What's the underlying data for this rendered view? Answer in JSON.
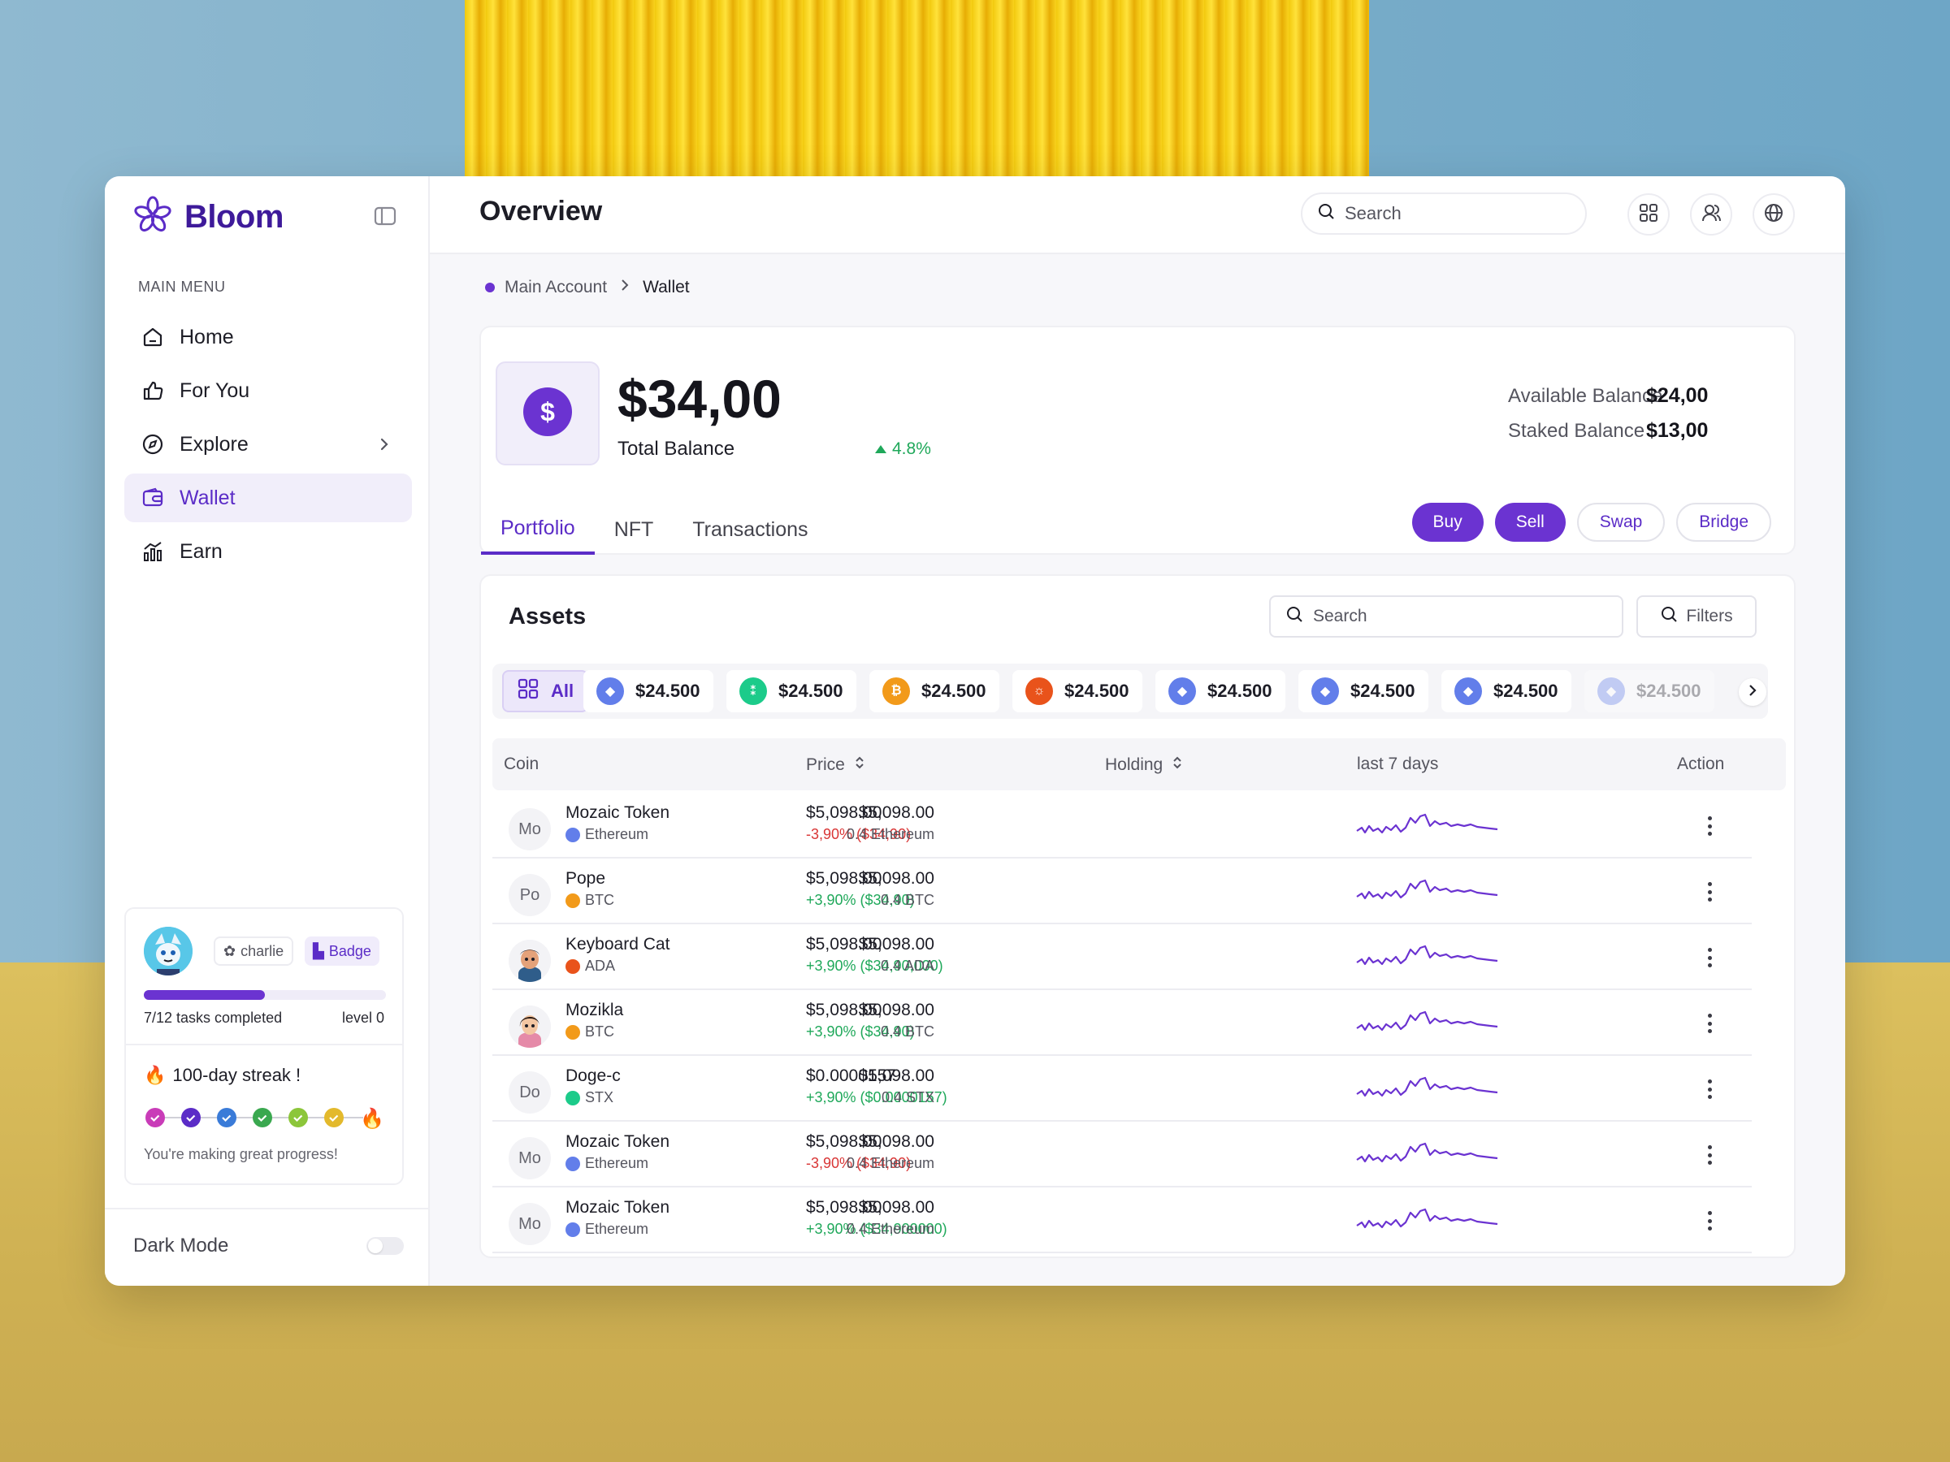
{
  "app": {
    "name": "Bloom"
  },
  "sidebar": {
    "menu_title": "MAIN MENU",
    "items": [
      {
        "label": "Home",
        "icon": "home-icon"
      },
      {
        "label": "For You",
        "icon": "thumbs-up-icon"
      },
      {
        "label": "Explore",
        "icon": "compass-icon"
      },
      {
        "label": "Wallet",
        "icon": "wallet-icon",
        "active": true
      },
      {
        "label": "Earn",
        "icon": "bar-chart-icon"
      }
    ],
    "profile": {
      "username": "charlie",
      "badge": "Badge",
      "tasks": "7/12 tasks completed",
      "tasks_fraction": 0.5,
      "level": "level 0",
      "streak": "100-day streak !",
      "streak_emoji": "🔥",
      "progress_note": "You're making great progress!"
    },
    "dark_mode_label": "Dark Mode",
    "dark_mode_on": false
  },
  "header": {
    "title": "Overview",
    "search_placeholder": "Search"
  },
  "breadcrumb": {
    "first": "Main Account",
    "last": "Wallet"
  },
  "balance": {
    "amount": "$34,00",
    "label": "Total Balance",
    "change": "4.8%",
    "available_label": "Available Balance",
    "available_value": "$24,00",
    "staked_label": "Staked Balance",
    "staked_value": "$13,00"
  },
  "tabs": [
    "Portfolio",
    "NFT",
    "Transactions"
  ],
  "actions": {
    "buy": "Buy",
    "sell": "Sell",
    "swap": "Swap",
    "bridge": "Bridge"
  },
  "assets": {
    "title": "Assets",
    "search_placeholder": "Search",
    "filters_label": "Filters",
    "all_label": "All",
    "pills": [
      {
        "value": "$24.500",
        "color": "#627eea",
        "symbol": "◆"
      },
      {
        "value": "$24.500",
        "color": "#1ccb8a",
        "symbol": "⁑"
      },
      {
        "value": "$24.500",
        "color": "#f29a1a",
        "symbol": "₿"
      },
      {
        "value": "$24.500",
        "color": "#e9531b",
        "symbol": "☼"
      },
      {
        "value": "$24.500",
        "color": "#627eea",
        "symbol": "◆"
      },
      {
        "value": "$24.500",
        "color": "#627eea",
        "symbol": "◆"
      },
      {
        "value": "$24.500",
        "color": "#627eea",
        "symbol": "◆"
      },
      {
        "value": "$24.500",
        "color": "#627eea",
        "symbol": "◆"
      }
    ],
    "columns": {
      "coin": "Coin",
      "price": "Price",
      "holding": "Holding",
      "last7": "last 7 days",
      "action": "Action"
    },
    "rows": [
      {
        "avatar": "Mo",
        "name": "Mozaic Token",
        "network": "Ethereum",
        "net_color": "#627eea",
        "price": "$5,098.00",
        "change": "-3,90% ($34,90)",
        "trend": "down",
        "holding": "$5,098.00",
        "holding_sub": "0.4 Ethereum"
      },
      {
        "avatar": "Po",
        "name": "Pope",
        "network": "BTC",
        "net_color": "#f29a1a",
        "price": "$5,098.00",
        "change": "+3,90% ($34,90)",
        "trend": "up",
        "holding": "$5,098.00",
        "holding_sub": "0.4 BTC"
      },
      {
        "avatar": "",
        "avatar_img": "cat",
        "name": "Keyboard Cat",
        "network": "ADA",
        "net_color": "#e9531b",
        "price": "$5,098.00",
        "change": "+3,90% ($34,90,000)",
        "trend": "up",
        "holding": "$5,098.00",
        "holding_sub": "0.4 ADA"
      },
      {
        "avatar": "",
        "avatar_img": "girl",
        "name": "Mozikla",
        "network": "BTC",
        "net_color": "#f29a1a",
        "price": "$5,098.00",
        "change": "+3,90% ($34,90)",
        "trend": "up",
        "holding": "$5,098.00",
        "holding_sub": "0.4 BTC"
      },
      {
        "avatar": "Do",
        "name": "Doge-c",
        "network": "STX",
        "net_color": "#1ccb8a",
        "price": "$0.0000157",
        "change": "+3,90% ($0.0000157)",
        "trend": "up",
        "holding": "$5,098.00",
        "holding_sub": "0.4 STX"
      },
      {
        "avatar": "Mo",
        "name": "Mozaic Token",
        "network": "Ethereum",
        "net_color": "#627eea",
        "price": "$5,098.00",
        "change": "-3,90% ($34,90)",
        "trend": "down",
        "holding": "$5,098.00",
        "holding_sub": "0.4 Ethereum"
      },
      {
        "avatar": "Mo",
        "name": "Mozaic Token",
        "network": "Ethereum",
        "net_color": "#627eea",
        "price": "$5,098.00",
        "change": "+3,90% ($34,900000)",
        "trend": "up",
        "holding": "$5,098.00",
        "holding_sub": "0.4 Ethereum"
      }
    ]
  },
  "colors": {
    "accent": "#6b33d1",
    "up": "#1fa85a",
    "down": "#d93636"
  }
}
